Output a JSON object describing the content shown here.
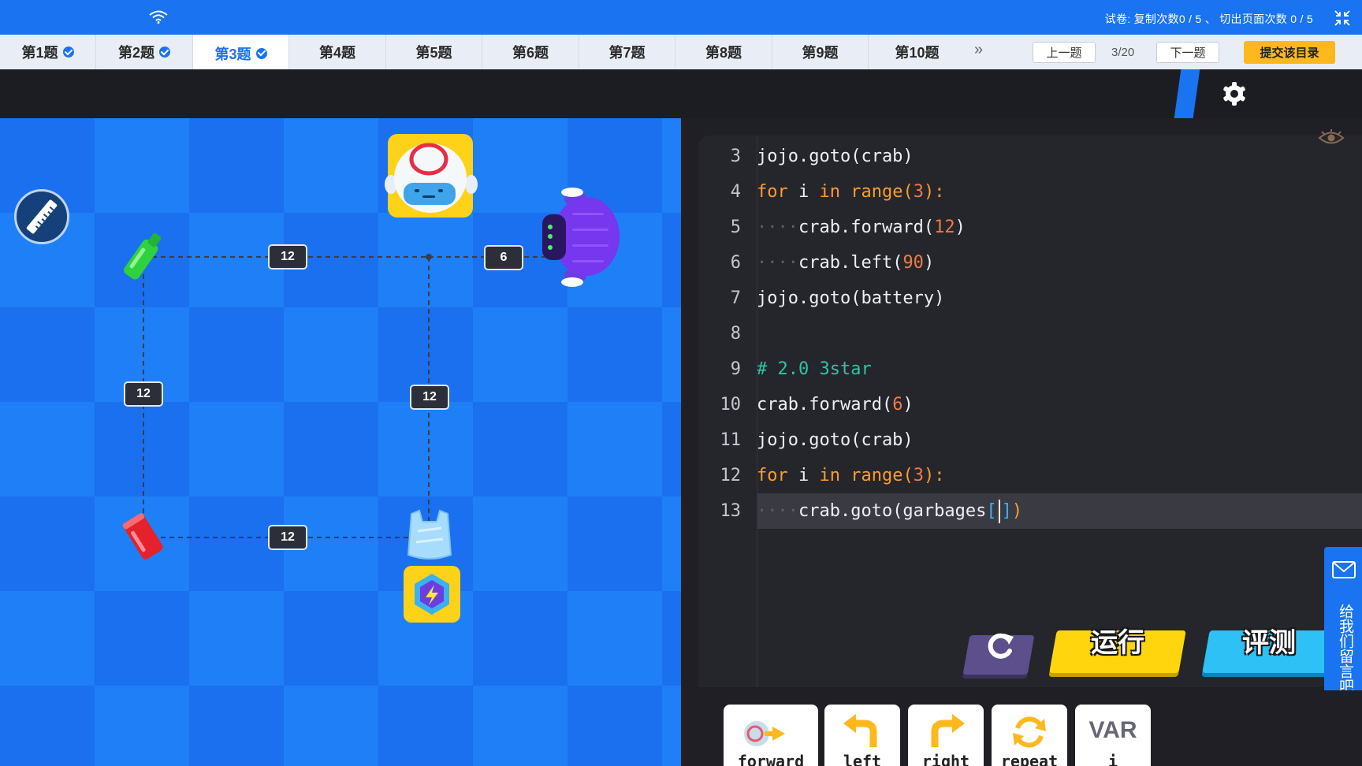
{
  "exam_info": "试卷:  复制次数0 / 5 、 切出页面次数 0 / 5",
  "tabs": [
    {
      "label": "第1题",
      "done": true
    },
    {
      "label": "第2题",
      "done": true
    },
    {
      "label": "第3题",
      "done": true,
      "active": true
    },
    {
      "label": "第4题"
    },
    {
      "label": "第5题"
    },
    {
      "label": "第6题"
    },
    {
      "label": "第7题"
    },
    {
      "label": "第8题"
    },
    {
      "label": "第9题"
    },
    {
      "label": "第10题"
    }
  ],
  "more_tabs": "»",
  "nav": {
    "prev": "上一题",
    "page": "3/20",
    "next": "下一题",
    "submit": "提交该目录"
  },
  "game": {
    "edge_labels": [
      "12",
      "6",
      "12",
      "12",
      "12"
    ]
  },
  "code": {
    "lines": [
      {
        "n": "3"
      },
      {
        "n": "4"
      },
      {
        "n": "5"
      },
      {
        "n": "6"
      },
      {
        "n": "7"
      },
      {
        "n": "8"
      },
      {
        "n": "9"
      },
      {
        "n": "10"
      },
      {
        "n": "11"
      },
      {
        "n": "12"
      },
      {
        "n": "13"
      }
    ],
    "t": {
      "l3": "jojo.goto(crab)",
      "l4_kw1": "for",
      "l4_mid": " i ",
      "l4_kw2": "in",
      "l4_fn": " range(",
      "l4_num": "3",
      "l4_end": "):",
      "indent": "····",
      "l5_a": "crab.forward(",
      "l5_num": "12",
      "l5_b": ")",
      "l6_a": "crab.left(",
      "l6_num": "90",
      "l6_b": ")",
      "l7": "jojo.goto(battery)",
      "l9": "# 2.0 3star",
      "l10_a": "crab.forward(",
      "l10_num": "6",
      "l10_b": ")",
      "l11": "jojo.goto(crab)",
      "l13_a": "crab.goto(garbages",
      "l13_br_open": "[",
      "l13_br_close": "]",
      "l13_b": ")"
    }
  },
  "buttons": {
    "run": "运行",
    "judge": "评测"
  },
  "feedback": "给我们留言吧",
  "blocks": [
    {
      "label": "forward"
    },
    {
      "label": "left"
    },
    {
      "label": "right"
    },
    {
      "label": "repeat"
    },
    {
      "title": "VAR",
      "label": "i"
    }
  ],
  "icons": {
    "wifi": "wifi-icon",
    "collapse": "collapse-icon",
    "gear": "gear-icon",
    "ruler": "ruler-icon",
    "eye": "eye-icon",
    "reset": "reset-icon",
    "mail": "mail-icon"
  },
  "colors": {
    "accent": "#1a73f0",
    "submit": "#fdb81d",
    "run": "#ffd60e",
    "judge": "#2dc1f5"
  }
}
